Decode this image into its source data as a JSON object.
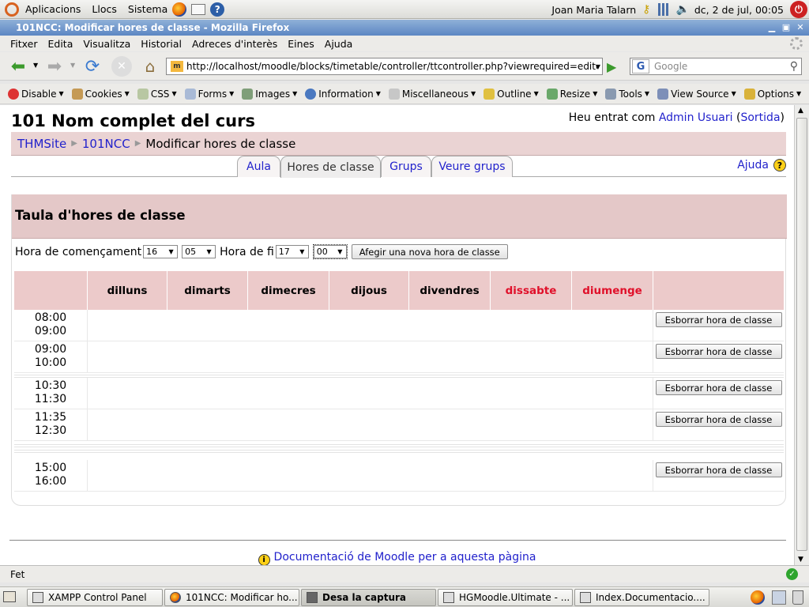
{
  "top_panel": {
    "menus": [
      "Aplicacions",
      "Llocs",
      "Sistema"
    ],
    "user": "Joan Maria Talarn",
    "datetime": "dc,  2 de jul, 00:05"
  },
  "window": {
    "title": "101NCC: Modificar hores de classe - Mozilla Firefox"
  },
  "menubar": [
    "Fitxer",
    "Edita",
    "Visualitza",
    "Historial",
    "Adreces d'interès",
    "Eines",
    "Ajuda"
  ],
  "navbar": {
    "url": "http://localhost/moodle/blocks/timetable/controller/ttcontroller.php?viewrequired=editcla",
    "search_placeholder": "Google"
  },
  "devbar": [
    "Disable",
    "Cookies",
    "CSS",
    "Forms",
    "Images",
    "Information",
    "Miscellaneous",
    "Outline",
    "Resize",
    "Tools",
    "View Source",
    "Options"
  ],
  "page": {
    "course_title": "101 Nom complet del curs",
    "login_prefix": "Heu entrat com",
    "login_user": "Admin Usuari",
    "login_logout": "Sortida",
    "breadcrumb": [
      "THMSite",
      "101NCC",
      "Modificar hores de classe"
    ],
    "tabs": [
      "Aula",
      "Hores de classe",
      "Grups",
      "Veure grups"
    ],
    "help_label": "Ajuda",
    "box_title": "Taula d'hores de classe",
    "form": {
      "start_label": "Hora de començament",
      "start_hour": "16",
      "start_min": "05",
      "end_label": "Hora de fi",
      "end_hour": "17",
      "end_min": "00",
      "add_button": "Afegir una nova hora de classe"
    },
    "days": [
      "dilluns",
      "dimarts",
      "dimecres",
      "dijous",
      "divendres",
      "dissabte",
      "diumenge"
    ],
    "weekend_color": "#e0102a",
    "rows": [
      {
        "start": "08:00",
        "end": "09:00",
        "action": "Esborrar hora de classe"
      },
      {
        "start": "09:00",
        "end": "10:00",
        "action": "Esborrar hora de classe"
      },
      {
        "start": "10:30",
        "end": "11:30",
        "action": "Esborrar hora de classe"
      },
      {
        "start": "11:35",
        "end": "12:30",
        "action": "Esborrar hora de classe"
      },
      {
        "start": "15:00",
        "end": "16:00",
        "action": "Esborrar hora de classe"
      }
    ],
    "docs_link": "Documentació de Moodle per a aquesta pàgina"
  },
  "statusbar": {
    "text": "Fet"
  },
  "taskbar": [
    {
      "label": "XAMPP Control Panel"
    },
    {
      "label": "101NCC: Modificar ho..."
    },
    {
      "label": "Desa la captura"
    },
    {
      "label": "HGMoodle.Ultimate - ..."
    },
    {
      "label": "Index.Documentacio...."
    }
  ],
  "icons": {
    "ubuntu": "ubuntu-logo-icon",
    "firefox": "firefox-icon",
    "mail": "mail-icon",
    "help": "help-icon",
    "power": "power-icon"
  }
}
